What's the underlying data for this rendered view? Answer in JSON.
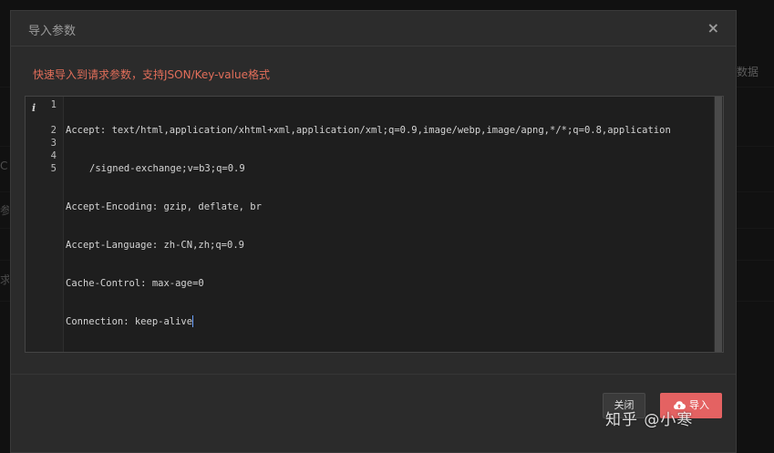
{
  "background": {
    "right_text": "数据",
    "left_glyphs": [
      "C",
      "参",
      "求"
    ]
  },
  "modal": {
    "title": "导入参数",
    "close_icon": "×",
    "hint": "快速导入到请求参数，支持JSON/Key-value格式",
    "editor": {
      "info_icon": "i",
      "line_numbers": [
        "1",
        "2",
        "3",
        "4",
        "5"
      ],
      "lines": [
        "Accept: text/html,application/xhtml+xml,application/xml;q=0.9,image/webp,image/apng,*/*;q=0.8,application",
        "/signed-exchange;v=b3;q=0.9",
        "Accept-Encoding: gzip, deflate, br",
        "Accept-Language: zh-CN,zh;q=0.9",
        "Cache-Control: max-age=0",
        "Connection: keep-alive"
      ]
    },
    "footer": {
      "close_label": "关闭",
      "import_label": "导入",
      "import_icon": "cloud-upload-icon"
    }
  },
  "watermark": "知乎 @小寒",
  "colors": {
    "hint": "#e26e5a",
    "primary_button": "#e46262",
    "cursor": "#6aa0ff"
  }
}
